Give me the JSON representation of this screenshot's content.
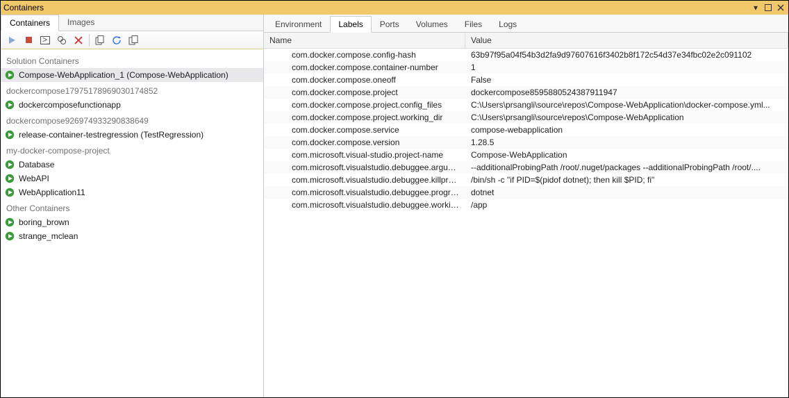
{
  "title": "Containers",
  "left_tabs": [
    "Containers",
    "Images"
  ],
  "active_left_tab": 0,
  "groups": [
    {
      "header": "Solution Containers",
      "items": [
        {
          "label": "Compose-WebApplication_1 (Compose-WebApplication)",
          "selected": true
        }
      ]
    },
    {
      "header": "dockercompose17975178969030174852",
      "items": [
        {
          "label": "dockercomposefunctionapp"
        }
      ]
    },
    {
      "header": "dockercompose926974933290838649",
      "items": [
        {
          "label": "release-container-testregression (TestRegression)"
        }
      ]
    },
    {
      "header": "my-docker-compose-project",
      "items": [
        {
          "label": "Database"
        },
        {
          "label": "WebAPI"
        },
        {
          "label": "WebApplication11"
        }
      ]
    },
    {
      "header": "Other Containers",
      "items": [
        {
          "label": "boring_brown"
        },
        {
          "label": "strange_mclean"
        }
      ]
    }
  ],
  "right_tabs": [
    "Environment",
    "Labels",
    "Ports",
    "Volumes",
    "Files",
    "Logs"
  ],
  "active_right_tab": 1,
  "grid_headers": {
    "name": "Name",
    "value": "Value"
  },
  "labels": [
    {
      "name": "com.docker.compose.config-hash",
      "value": "63b97f95a04f54b3d2fa9d97607616f3402b8f172c54d37e34fbc02e2c091102"
    },
    {
      "name": "com.docker.compose.container-number",
      "value": "1"
    },
    {
      "name": "com.docker.compose.oneoff",
      "value": "False"
    },
    {
      "name": "com.docker.compose.project",
      "value": "dockercompose8595880524387911947"
    },
    {
      "name": "com.docker.compose.project.config_files",
      "value": "C:\\Users\\prsangli\\source\\repos\\Compose-WebApplication\\docker-compose.yml..."
    },
    {
      "name": "com.docker.compose.project.working_dir",
      "value": "C:\\Users\\prsangli\\source\\repos\\Compose-WebApplication"
    },
    {
      "name": "com.docker.compose.service",
      "value": "compose-webapplication"
    },
    {
      "name": "com.docker.compose.version",
      "value": "1.28.5"
    },
    {
      "name": "com.microsoft.visual-studio.project-name",
      "value": "Compose-WebApplication"
    },
    {
      "name": "com.microsoft.visualstudio.debuggee.arguments",
      "value": " --additionalProbingPath /root/.nuget/packages --additionalProbingPath /root/...."
    },
    {
      "name": "com.microsoft.visualstudio.debuggee.killprogram",
      "value": "/bin/sh -c \"if PID=$(pidof dotnet); then kill $PID; fi\""
    },
    {
      "name": "com.microsoft.visualstudio.debuggee.program",
      "value": "dotnet"
    },
    {
      "name": "com.microsoft.visualstudio.debuggee.workingdire...",
      "value": "/app"
    }
  ]
}
